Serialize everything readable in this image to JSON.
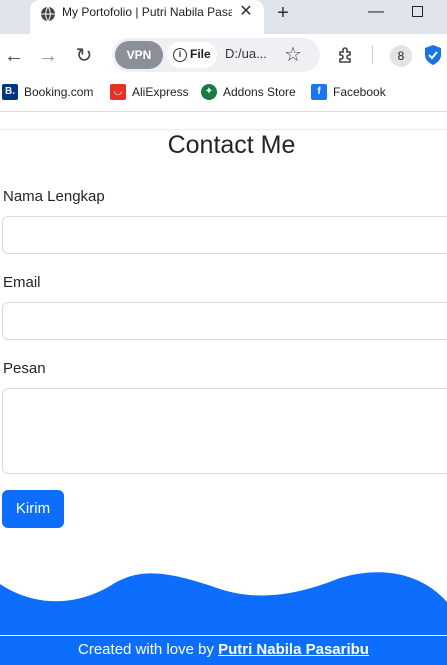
{
  "browser": {
    "tab_title": "My Portofolio | Putri Nabila Pasaribu",
    "tab_close": "✕",
    "new_tab": "+",
    "minimize": "—",
    "vpn_label": "VPN",
    "info_label": "File",
    "url": "D:/ua...",
    "profile_initial": "8",
    "bookmarks": [
      {
        "label": "Booking.com",
        "icon": "B.",
        "color": "#003580"
      },
      {
        "label": "AliExpress",
        "icon": "",
        "color": "#e43225"
      },
      {
        "label": "Addons Store",
        "icon": "",
        "color": "#1b7a3e"
      },
      {
        "label": "Facebook",
        "icon": "f",
        "color": "#1877f2"
      }
    ]
  },
  "page": {
    "title": "Contact Me",
    "fields": {
      "name_label": "Nama Lengkap",
      "email_label": "Email",
      "message_label": "Pesan"
    },
    "submit_label": "Kirim",
    "footer": {
      "prefix": "Created with love by ",
      "author": "Putri Nabila Pasaribu"
    }
  },
  "colors": {
    "primary": "#0d6efd",
    "tabstrip": "#dfe3eb"
  }
}
